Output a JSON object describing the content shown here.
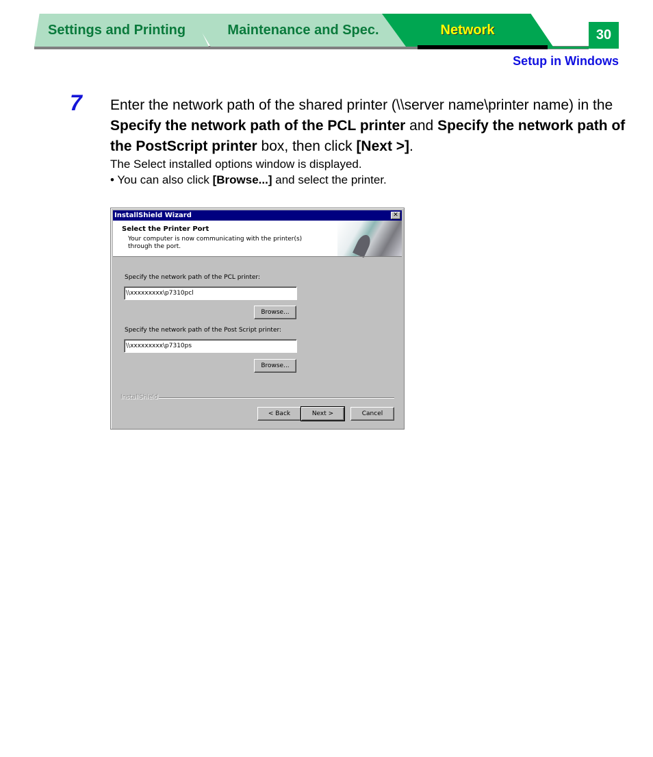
{
  "nav": {
    "tabs": [
      {
        "label": "Settings and Printing",
        "active": false
      },
      {
        "label": "Maintenance and Spec.",
        "active": false
      },
      {
        "label": "Network",
        "active": true
      }
    ],
    "page_number": "30",
    "colors": {
      "tab_inactive": "#b0dec4",
      "tab_active": "#00a651",
      "active_text": "#ffff00",
      "inactive_text": "#0a7a3c"
    }
  },
  "section_title": "Setup in Windows",
  "step": {
    "number": "7",
    "text_parts": [
      "Enter the network path of the shared printer (\\\\server name\\printer name) in the ",
      "Specify the network path of the PCL printer",
      " and ",
      "Specify the network path of the PostScript printer",
      " box, then click ",
      "[Next >]",
      "."
    ],
    "result": "The Select installed options window is displayed.",
    "bullet_prefix": "• You can also click ",
    "bullet_bold": "[Browse...]",
    "bullet_suffix": " and select the printer."
  },
  "dialog": {
    "title": "InstallShield Wizard",
    "close_label": "✕",
    "header_title": "Select the Printer Port",
    "header_desc": "Your computer is now communicating with the printer(s) through the port.",
    "pcl_label": "Specify the network path of the PCL printer:",
    "pcl_value": "\\\\xxxxxxxxx\\p7310pcl",
    "browse_label": "Browse...",
    "ps_label": "Specify the network path of the Post Script printer:",
    "ps_value": "\\\\xxxxxxxxx\\p7310ps",
    "brand": "InstallShield",
    "back_label": "< Back",
    "next_label": "Next >",
    "cancel_label": "Cancel"
  }
}
